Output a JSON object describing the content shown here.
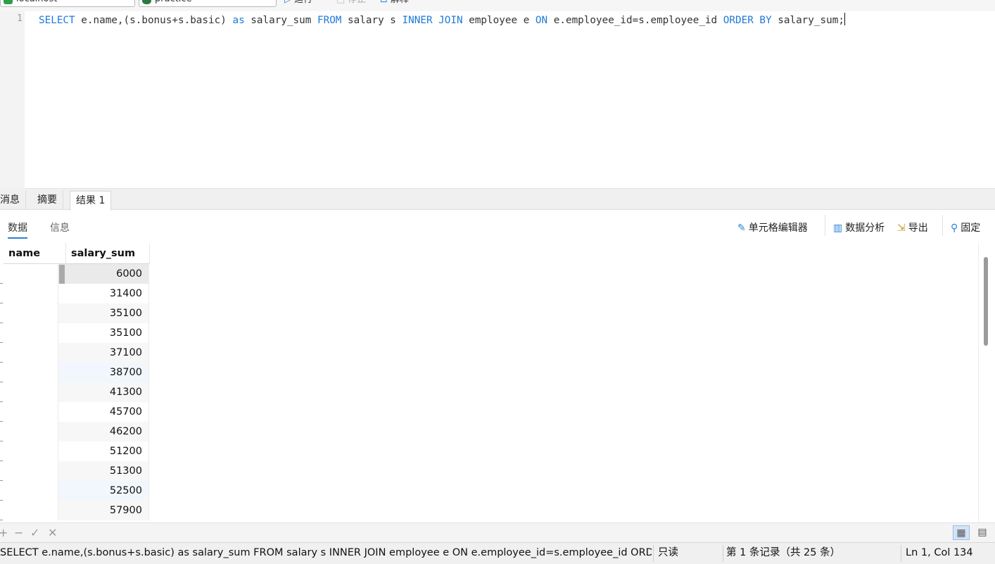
{
  "toolbar": {
    "connection": "localhost",
    "database": "practice",
    "run_label": "运行",
    "stop_label": "停止",
    "explain_label": "解释"
  },
  "editor": {
    "line_number": "1",
    "sql": "SELECT e.name,(s.bonus+s.basic) as salary_sum FROM salary s INNER JOIN employee e ON e.employee_id=s.employee_id ORDER BY salary_sum;"
  },
  "result_tabs": [
    "消息",
    "摘要",
    "结果 1"
  ],
  "sub_tabs": {
    "data": "数据",
    "info": "信息"
  },
  "tools": {
    "cell_editor": "单元格编辑器",
    "data_analysis": "数据分析",
    "export": "导出",
    "pin": "固定"
  },
  "grid": {
    "columns": [
      "name",
      "salary_sum"
    ],
    "rows": [
      {
        "name": "",
        "salary_sum": "6000"
      },
      {
        "name": "",
        "salary_sum": "31400"
      },
      {
        "name": "",
        "salary_sum": "35100"
      },
      {
        "name": "",
        "salary_sum": "35100"
      },
      {
        "name": "",
        "salary_sum": "37100"
      },
      {
        "name": "",
        "salary_sum": "38700"
      },
      {
        "name": "",
        "salary_sum": "41300"
      },
      {
        "name": "",
        "salary_sum": "45700"
      },
      {
        "name": "",
        "salary_sum": "46200"
      },
      {
        "name": "",
        "salary_sum": "51200"
      },
      {
        "name": "",
        "salary_sum": "51300"
      },
      {
        "name": "",
        "salary_sum": "52500"
      },
      {
        "name": "",
        "salary_sum": "57900"
      }
    ]
  },
  "grid_toolbar": {
    "add": "+",
    "remove": "−",
    "apply": "✓",
    "discard": "✕"
  },
  "status": {
    "query": "SELECT e.name,(s.bonus+s.basic) as salary_sum FROM salary s INNER JOIN employee e ON e.employee_id=s.employee_id ORDER BY salary_sum;",
    "mode": "只读",
    "record": "第 1 条记录（共 25 条）",
    "position": "Ln 1, Col 134"
  },
  "colors": {
    "keyword": "#1f7ad6",
    "accent": "#2d7fd3",
    "selected_row": "#eaeaea",
    "alt_row": "#f7f7f7",
    "highlight_row": "#f2f7fd"
  }
}
